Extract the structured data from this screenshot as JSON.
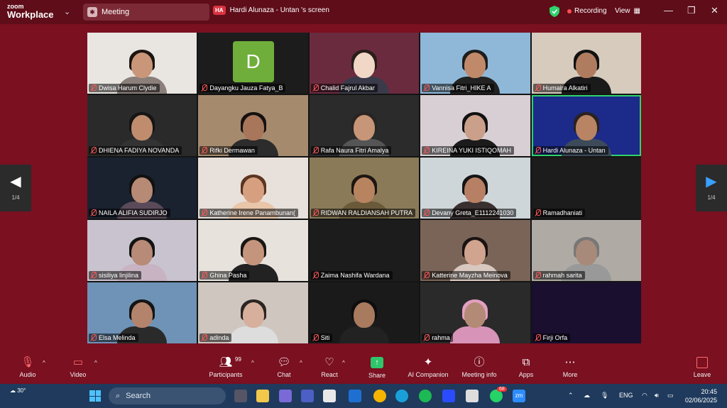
{
  "app": {
    "brand_top": "zoom",
    "brand_bottom": "Workplace"
  },
  "titlebar": {
    "meeting_tab": "Meeting",
    "share_badge": "HA",
    "share_title": "Hardi Alunaza - Untan 's screen",
    "recording": "Recording",
    "view": "View"
  },
  "gallery": {
    "page_indicator": "1/4",
    "participants": [
      {
        "name": "Dwisa Harum Clydie",
        "type": "video",
        "bg": "#e9e6e2",
        "skin": "#c9967a",
        "hair": "#1c1410",
        "body": "#8a7f7a"
      },
      {
        "name": "Dayangku Jauza Fatya_B",
        "type": "avatar",
        "initial": "D"
      },
      {
        "name": "Chalid Fajrul Akbar",
        "type": "video",
        "bg": "#6b2b3f",
        "skin": "#f1d7c6",
        "hair": "#2a1e1a",
        "body": "#3a3a4a"
      },
      {
        "name": "Vannisa Fitri_HIKE A",
        "type": "video",
        "bg": "#8fb8d8",
        "skin": "#c08a6a",
        "hair": "#1d1d1d",
        "body": "#222"
      },
      {
        "name": "Humaira Alkatiri",
        "type": "video",
        "bg": "#d6cbbd",
        "skin": "#b07c60",
        "hair": "#111",
        "body": "#1a1a1a"
      },
      {
        "name": "DHIENA FADIYA NOVANDA",
        "type": "video",
        "bg": "#2a2a2a",
        "skin": "#bf8c6e",
        "hair": "#151515",
        "body": "#333"
      },
      {
        "name": "Rifki Dermawan",
        "type": "video",
        "bg": "#a58a6e",
        "skin": "#a8765a",
        "hair": "#151010",
        "body": "#2c2c2c"
      },
      {
        "name": "Rafa Naura Fitri Amalya",
        "type": "video",
        "bg": "#2b2b2b",
        "skin": "#c79577",
        "hair": "#2a2522",
        "body": "#555"
      },
      {
        "name": "KIREINA YUKI ISTIQOMAH",
        "type": "video",
        "bg": "#d8cfd4",
        "skin": "#caa08a",
        "hair": "#111",
        "body": "#1b1b1b"
      },
      {
        "name": "Hardi Alunaza - Untan",
        "type": "video",
        "bg": "#1c2a8a",
        "skin": "#b98463",
        "hair": "#2a2220",
        "body": "#3d4a5a",
        "active": true
      },
      {
        "name": "NAILA ALIFIA SUDIRJO",
        "type": "video",
        "bg": "#1a2230",
        "skin": "#b68a74",
        "hair": "#111",
        "body": "#5a4a5a"
      },
      {
        "name": "Katherine Irene Panambunan(",
        "type": "video",
        "bg": "#e8e0da",
        "skin": "#d6a080",
        "hair": "#5a3520",
        "body": "#e9c6a9"
      },
      {
        "name": "RIDWAN RALDIANSAH PUTRA",
        "type": "video",
        "bg": "#8a7a58",
        "skin": "#b8845f",
        "hair": "#1c1612",
        "body": "#6a5a3a"
      },
      {
        "name": "Devany Greta_E1112241030",
        "type": "video",
        "bg": "#cfd6d9",
        "skin": "#b77f63",
        "hair": "#151515",
        "body": "#3a3030"
      },
      {
        "name": "Ramadhaniati",
        "type": "off"
      },
      {
        "name": "sisiliya linjilina",
        "type": "video",
        "bg": "#c9c3cf",
        "skin": "#b88a78",
        "hair": "#131313",
        "body": "#c7b3c1"
      },
      {
        "name": "Ghina Pasha",
        "type": "video",
        "bg": "#e8e2dc",
        "skin": "#c4957c",
        "hair": "#1a1614",
        "body": "#222"
      },
      {
        "name": "Zaima Nashifa Wardana",
        "type": "off"
      },
      {
        "name": "Katterine Mayzha Meinova",
        "type": "video",
        "bg": "#7a6458",
        "skin": "#d0a48e",
        "hair": "#1a1212",
        "body": "#d8c8c0"
      },
      {
        "name": "rahmah sarita",
        "type": "video",
        "bg": "#b0aaa4",
        "skin": "#a88a7a",
        "hair": "#777",
        "body": "#999"
      },
      {
        "name": "Elsa Melinda",
        "type": "video",
        "bg": "#6e93b7",
        "skin": "#b4836c",
        "hair": "#141414",
        "body": "#2a2a2a"
      },
      {
        "name": "adinda",
        "type": "video",
        "bg": "#cfc6c0",
        "skin": "#d6b09c",
        "hair": "#2c2422",
        "body": "#ddd"
      },
      {
        "name": "Siti",
        "type": "video",
        "bg": "#1a1a1a",
        "skin": "#a87a5e",
        "hair": "#0e0e0e",
        "body": "#222"
      },
      {
        "name": "rahma",
        "type": "video",
        "bg": "#2a2a2a",
        "skin": "#b38a76",
        "hair": "#e2a0c0",
        "body": "#d894b8"
      },
      {
        "name": "Firji Orfa",
        "type": "video",
        "bg": "#1a0f2e",
        "skin": "#1a0f2e",
        "hair": "#1a0f2e",
        "body": "#1a0f2e"
      }
    ]
  },
  "toolbar": {
    "audio": "Audio",
    "video": "Video",
    "participants": "Participants",
    "participants_count": "99",
    "chat": "Chat",
    "react": "React",
    "share": "Share",
    "ai_companion": "AI Companion",
    "meeting_info": "Meeting info",
    "apps": "Apps",
    "more": "More",
    "leave": "Leave"
  },
  "taskbar": {
    "temperature": "30°",
    "search_placeholder": "Search",
    "notification_badge": "68",
    "app_label": "zm",
    "language": "ENG",
    "time": "20:45",
    "date": "02/06/2025"
  }
}
